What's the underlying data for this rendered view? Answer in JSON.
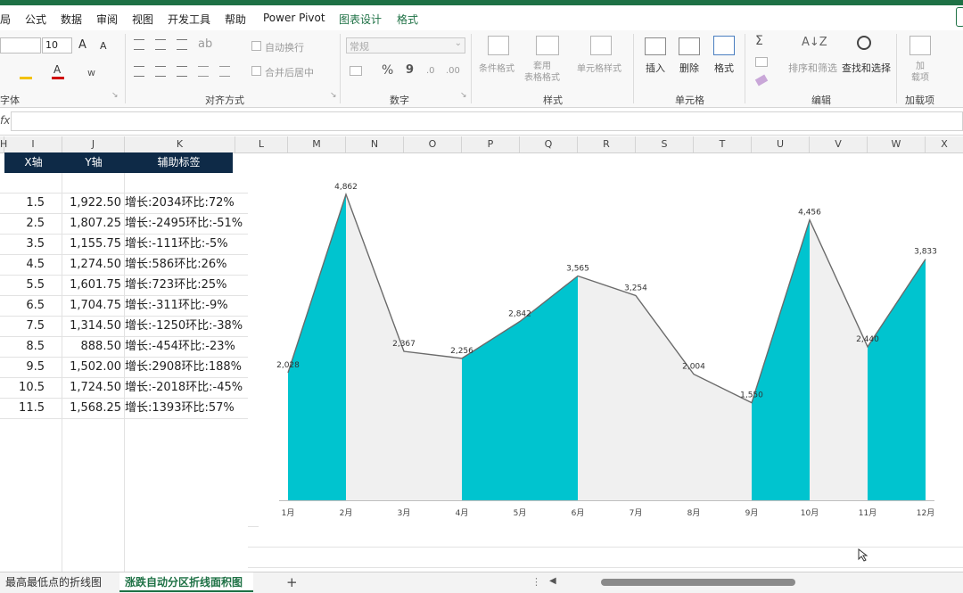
{
  "menu": {
    "items": [
      "局",
      "公式",
      "数据",
      "审阅",
      "视图",
      "开发工具",
      "帮助",
      "Power Pivot",
      "图表设计",
      "格式"
    ]
  },
  "ribbon": {
    "font_size": "10",
    "grow_font": "A",
    "shrink_font": "A",
    "wrap_text": "自动换行",
    "merge_center": "合并后居中",
    "number_format": "常规",
    "percent_symbol": "%",
    "comma_symbol": "9",
    "conditional_format": "条件格式",
    "table_format": "套用\n表格格式",
    "cell_styles": "单元格样式",
    "insert": "插入",
    "delete": "删除",
    "format": "格式",
    "sort_filter": "排序和筛选",
    "find_select": "查找和选择",
    "addins": "加\n载项",
    "groups": {
      "font": "字体",
      "alignment": "对齐方式",
      "number": "数字",
      "styles": "样式",
      "cells": "单元格",
      "editing": "编辑",
      "addins": "加载项"
    }
  },
  "formula_bar": {
    "fx": "fx"
  },
  "columns": [
    "H",
    "I",
    "J",
    "K",
    "L",
    "M",
    "N",
    "O",
    "P",
    "Q",
    "R",
    "S",
    "T",
    "U",
    "V",
    "W",
    "X"
  ],
  "table": {
    "headers": [
      "X轴",
      "Y轴",
      "辅助标签"
    ],
    "rows": [
      {
        "x": "1.5",
        "y": "1,922.50",
        "label": "增长:2034环比:72%"
      },
      {
        "x": "2.5",
        "y": "1,807.25",
        "label": "增长:-2495环比:-51%"
      },
      {
        "x": "3.5",
        "y": "1,155.75",
        "label": "增长:-111环比:-5%"
      },
      {
        "x": "4.5",
        "y": "1,274.50",
        "label": "增长:586环比:26%"
      },
      {
        "x": "5.5",
        "y": "1,601.75",
        "label": "增长:723环比:25%"
      },
      {
        "x": "6.5",
        "y": "1,704.75",
        "label": "增长:-311环比:-9%"
      },
      {
        "x": "7.5",
        "y": "1,314.50",
        "label": "增长:-1250环比:-38%"
      },
      {
        "x": "8.5",
        "y": "888.50",
        "label": "增长:-454环比:-23%"
      },
      {
        "x": "9.5",
        "y": "1,502.00",
        "label": "增长:2908环比:188%"
      },
      {
        "x": "10.5",
        "y": "1,724.50",
        "label": "增长:-2018环比:-45%"
      },
      {
        "x": "11.5",
        "y": "1,568.25",
        "label": "增长:1393环比:57%"
      }
    ]
  },
  "chart_data": {
    "type": "area",
    "categories": [
      "1月",
      "2月",
      "3月",
      "4月",
      "5月",
      "6月",
      "7月",
      "8月",
      "9月",
      "10月",
      "11月",
      "12月"
    ],
    "series": [
      {
        "values": [
          2028,
          4862,
          2367,
          2256,
          2842,
          3565,
          3254,
          2004,
          1550,
          4456,
          2440,
          3833
        ]
      }
    ],
    "data_labels": [
      "2,028",
      "4,862",
      "2,367",
      "2,256",
      "2,842",
      "3,565",
      "3,254",
      "2,004",
      "1,550",
      "4,456",
      "2,440",
      "3,833"
    ],
    "ylim": [
      0,
      5500
    ],
    "grid": false,
    "colors": {
      "rise": "#00c4cf",
      "fall": "#f0f0f0",
      "line": "#6b6b6b"
    }
  },
  "sheet_tabs": [
    "最高最低点的折线图",
    "涨跌自动分区折线面积图"
  ],
  "add_sheet": "+",
  "colors": {
    "excel_green": "#1e7145",
    "header_navy": "#0e2a47"
  }
}
